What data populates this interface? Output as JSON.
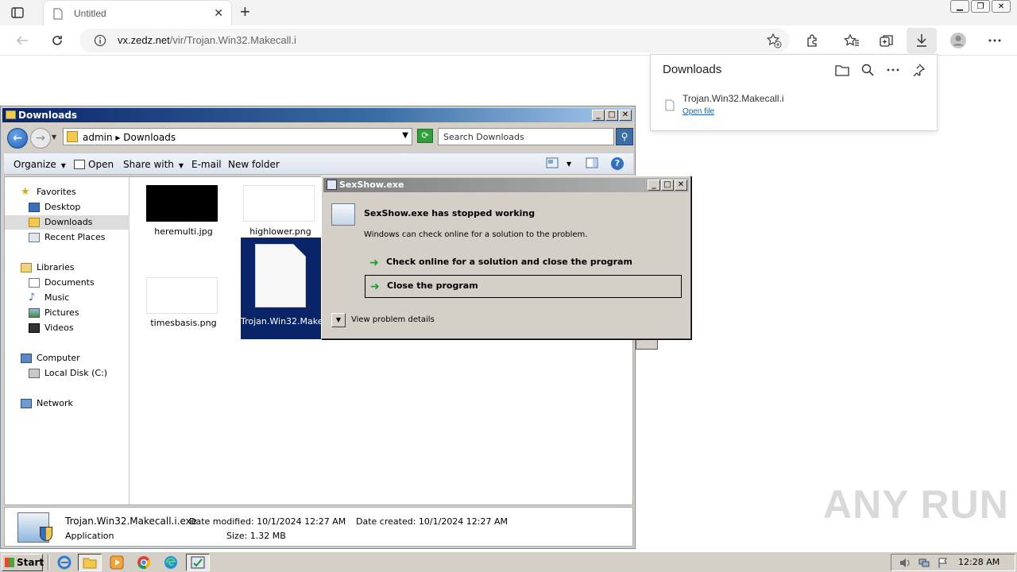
{
  "browser": {
    "tab_title": "Untitled",
    "url_host": "vx.zedz.net",
    "url_path": "/vir/Trojan.Win32.Makecall.i",
    "downloads_panel": {
      "title": "Downloads",
      "file_name": "Trojan.Win32.Makecall.i",
      "open_link": "Open file"
    }
  },
  "explorer": {
    "title": "Downloads",
    "breadcrumb": "admin ▸ Downloads",
    "search_placeholder": "Search Downloads",
    "commands": {
      "organize": "Organize",
      "open": "Open",
      "share_with": "Share with",
      "email": "E-mail",
      "new_folder": "New folder"
    },
    "nav": {
      "favorites": "Favorites",
      "desktop": "Desktop",
      "downloads": "Downloads",
      "recent_places": "Recent Places",
      "libraries": "Libraries",
      "documents": "Documents",
      "music": "Music",
      "pictures": "Pictures",
      "videos": "Videos",
      "computer": "Computer",
      "local_disk": "Local Disk (C:)",
      "network": "Network"
    },
    "files": [
      {
        "name": "heremulti.jpg"
      },
      {
        "name": "highlower.png"
      },
      {
        "name": "timesbasis.png"
      },
      {
        "name": "Trojan.Win32.Makecall.i.exe"
      }
    ],
    "details": {
      "file_name": "Trojan.Win32.Makecall.i.exe",
      "type": "Application",
      "date_modified_label": "Date modified:",
      "date_modified": "10/1/2024 12:27 AM",
      "date_created_label": "Date created:",
      "date_created": "10/1/2024 12:27 AM",
      "size_label": "Size:",
      "size": "1.32 MB"
    }
  },
  "dialog": {
    "title": "SexShow.exe",
    "heading": "SexShow.exe has stopped working",
    "message": "Windows can check online for a solution to the problem.",
    "option_check": "Check online for a solution and close the program",
    "option_close": "Close the program",
    "details": "View problem details"
  },
  "taskbar": {
    "start": "Start",
    "clock": "12:28 AM"
  },
  "watermark": "ANY RUN",
  "colors": {
    "title_active": "#0a246a",
    "title_inactive": "#808080",
    "selection": "#0a246a",
    "link": "#1a5fb4"
  }
}
